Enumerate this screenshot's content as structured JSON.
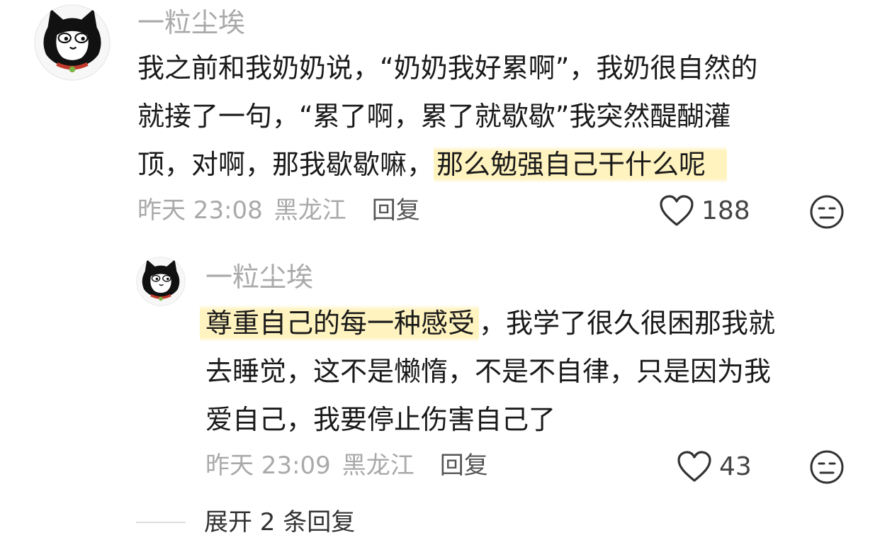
{
  "comment": {
    "username": "一粒尘埃",
    "lines": [
      "我之前和我奶奶说，“奶奶我好累啊”，我奶很自然的",
      "就接了一句，“累了啊，累了就歇歇”我突然醍醐灌",
      "顶，对啊，那我歇歇嘛，"
    ],
    "highlight": "那么勉强自己干什么呢",
    "time": "昨天 23:08",
    "location": "黑龙江",
    "reply_label": "回复",
    "likes": "188"
  },
  "reply": {
    "username": "一粒尘埃",
    "highlight": "尊重自己的每一种感受",
    "line1_rest": "，我学了很久很困那我就",
    "lines": [
      "去睡觉，这不是懒惰，不是不自律，只是因为我",
      "爱自己，我要停止伤害自己了"
    ],
    "time": "昨天 23:09",
    "location": "黑龙江",
    "reply_label": "回复",
    "likes": "43"
  },
  "expand_label": "展开 2 条回复",
  "icons": {
    "avatar": "cat-avatar-icon",
    "like": "heart-icon",
    "emoji": "meh-face-icon"
  },
  "colors": {
    "highlight": "#fff3bf",
    "muted": "#a9a9a9"
  }
}
